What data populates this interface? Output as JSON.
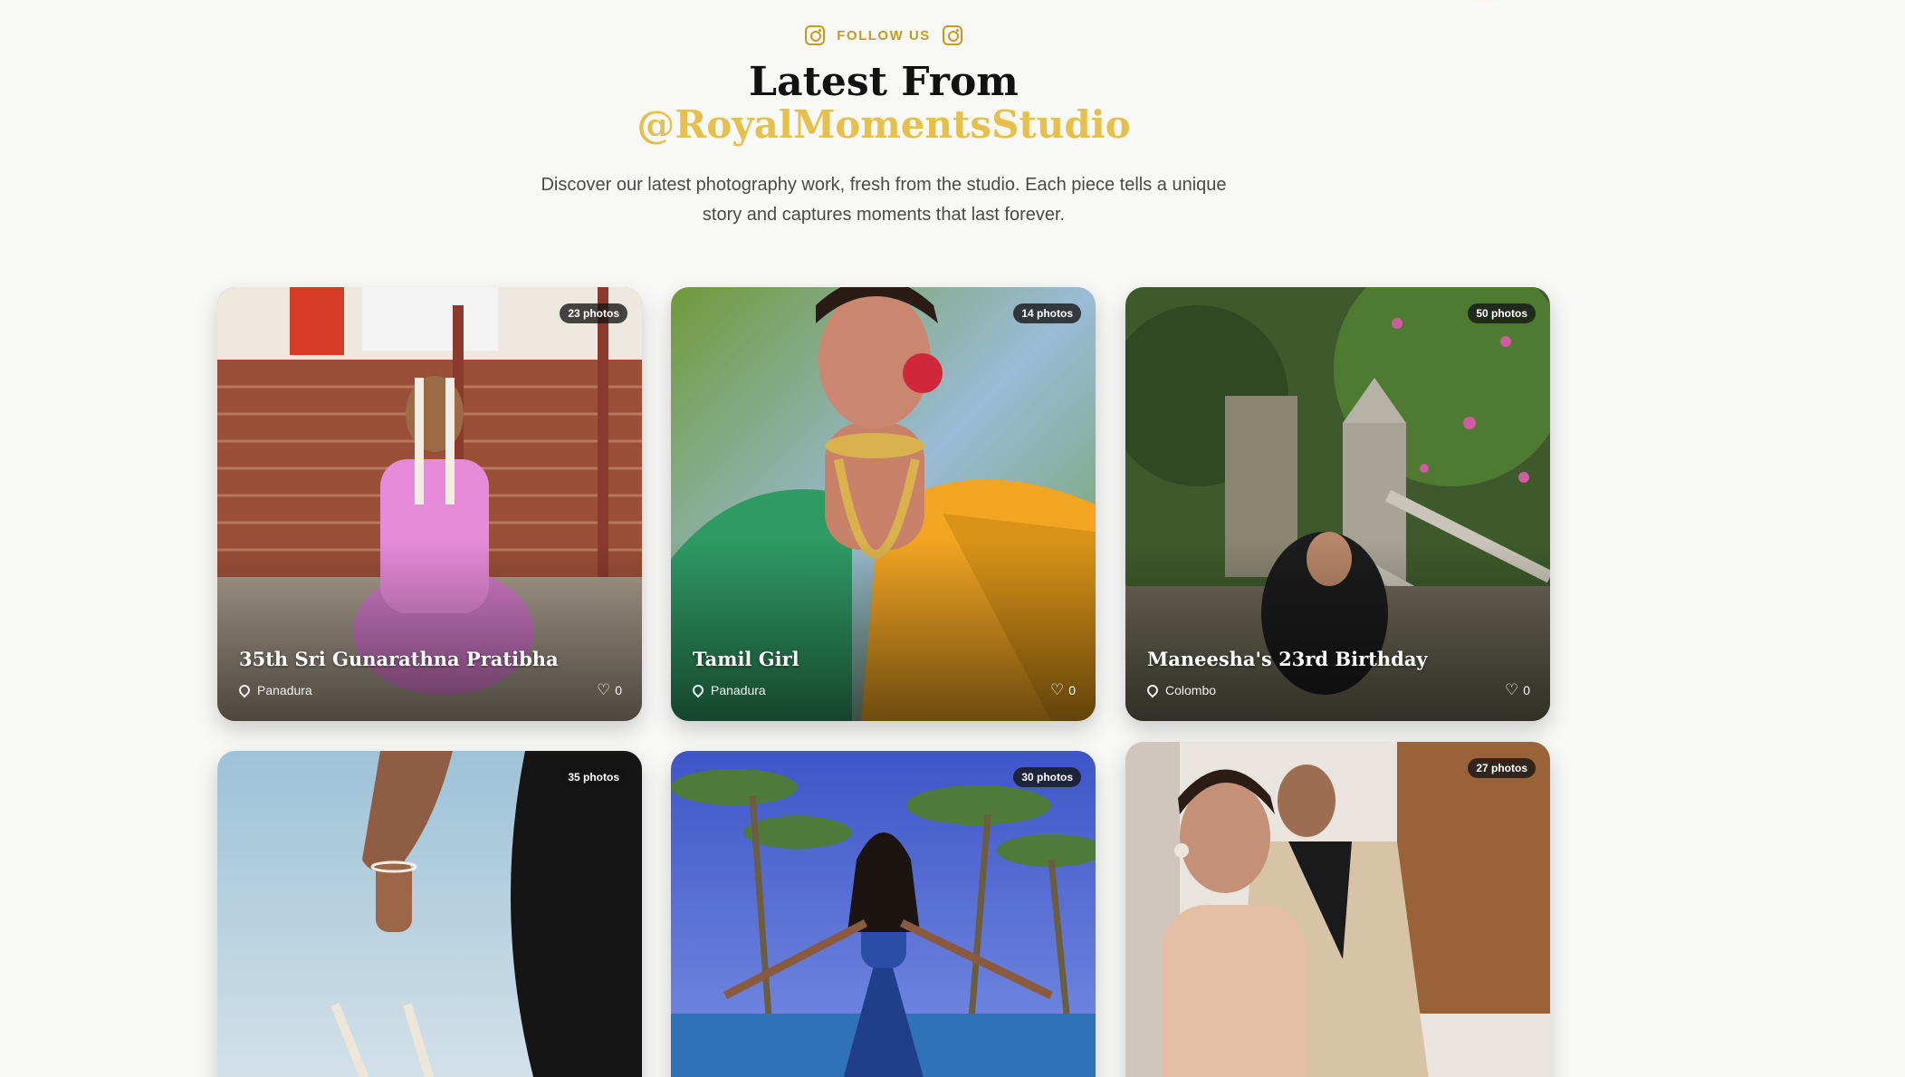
{
  "header": {
    "eyebrow_label": "FOLLOW US",
    "title": "Latest From",
    "handle": "@RoyalMomentsStudio",
    "description": "Discover our latest photography work, fresh from the studio. Each piece tells a unique story and captures moments that last forever."
  },
  "icons": {
    "eyebrow_left": "instagram-icon",
    "eyebrow_right": "instagram-icon",
    "location": "map-pin-icon",
    "likes": "heart-icon"
  },
  "colors": {
    "accent_gold": "#c89a23",
    "handle_gold": "#e6c04a",
    "badge_bg": "#141414"
  },
  "cards": [
    {
      "photos": "23 photos",
      "title": "35th Sri Gunarathna Pratibha",
      "location": "Panadura",
      "likes": "0"
    },
    {
      "photos": "14 photos",
      "title": "Tamil Girl",
      "location": "Panadura",
      "likes": "0"
    },
    {
      "photos": "50 photos",
      "title": "Maneesha's 23rd Birthday",
      "location": "Colombo",
      "likes": "0"
    },
    {
      "photos": "35 photos"
    },
    {
      "photos": "30 photos"
    },
    {
      "photos": "27 photos"
    }
  ]
}
